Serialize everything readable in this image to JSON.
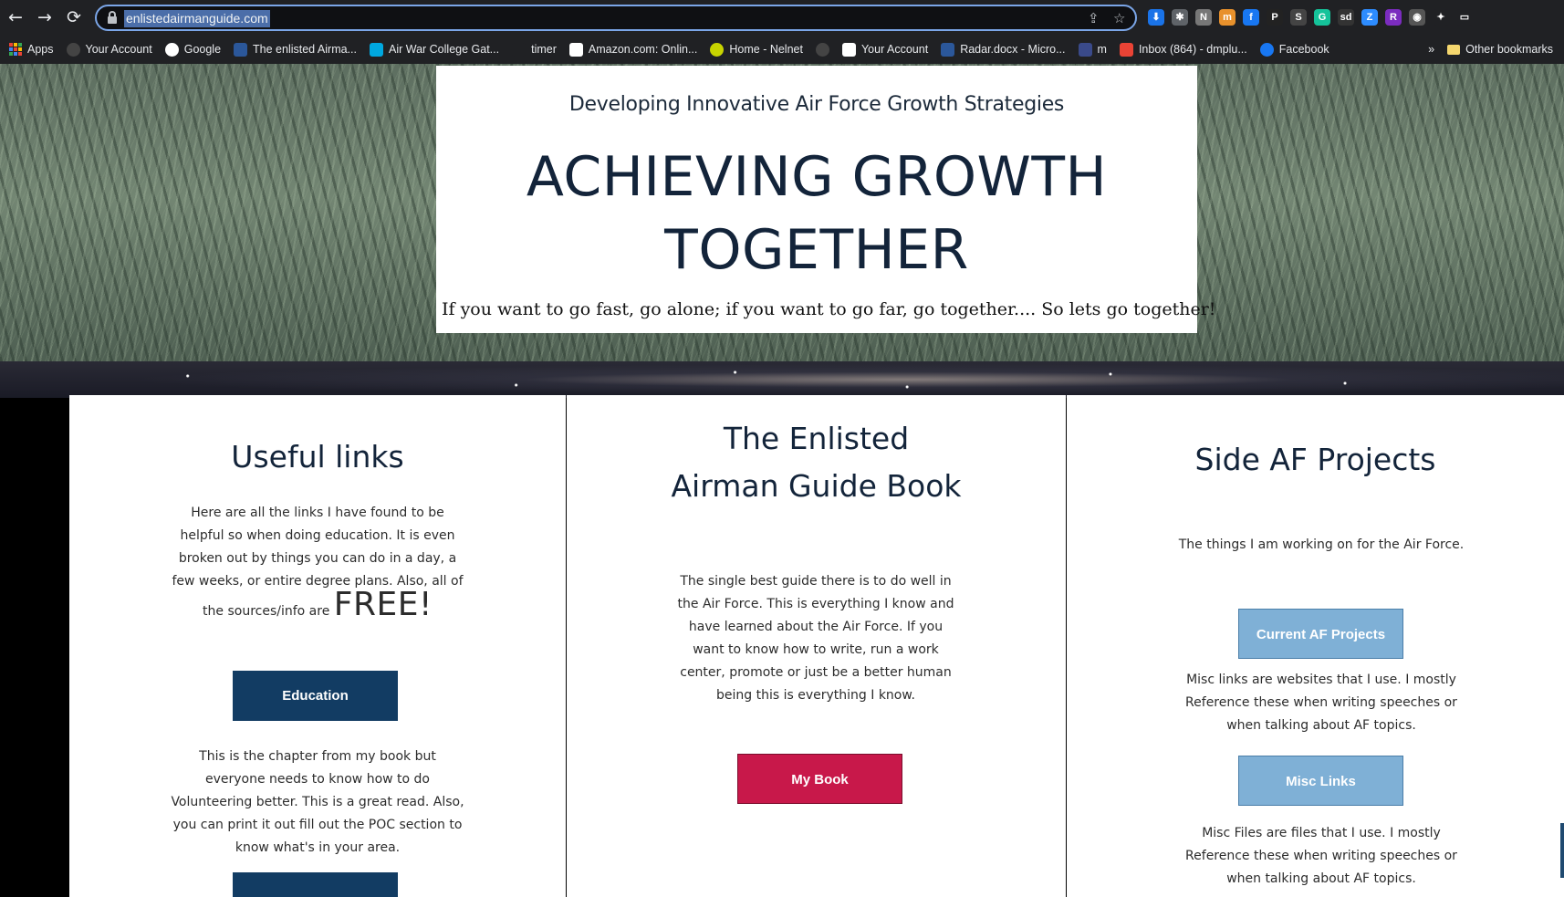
{
  "browser": {
    "url": "enlistedairmanguide.com",
    "nav": {
      "back": "←",
      "forward": "→",
      "reload": "⟳"
    },
    "omnibox_icons": [
      "share-icon",
      "star-icon"
    ],
    "extensions": [
      {
        "name": "download-icon",
        "glyph": "⬇",
        "color": "#1a73e8"
      },
      {
        "name": "puzzle-alt-icon",
        "glyph": "✱",
        "color": "#5f6368"
      },
      {
        "name": "book-ext-icon",
        "glyph": "N",
        "color": "#777777"
      },
      {
        "name": "orange-ext-icon",
        "glyph": "m",
        "color": "#e8912c"
      },
      {
        "name": "fb-ext-icon",
        "glyph": "f",
        "color": "#1877f2"
      },
      {
        "name": "p-ext-icon",
        "glyph": "P",
        "color": "#222222"
      },
      {
        "name": "s-ext-icon",
        "glyph": "S",
        "color": "#444444"
      },
      {
        "name": "grammarly-icon",
        "glyph": "G",
        "color": "#15c39a"
      },
      {
        "name": "sd-ext-icon",
        "glyph": "sd",
        "color": "#333333"
      },
      {
        "name": "zoom-icon",
        "glyph": "Z",
        "color": "#2d8cff"
      },
      {
        "name": "r-ext-icon",
        "glyph": "R",
        "color": "#7b2cbf"
      },
      {
        "name": "globe-ext-icon",
        "glyph": "◉",
        "color": "#555555"
      },
      {
        "name": "extensions-icon",
        "glyph": "✦",
        "color": "#202124"
      },
      {
        "name": "cast-icon",
        "glyph": "▭",
        "color": "#202124"
      }
    ],
    "bookmarks": [
      {
        "label": "Apps",
        "icon": "apps-grid-icon",
        "color": "#ffffff"
      },
      {
        "label": "Your Account",
        "icon": "account-icon",
        "color": "#444444"
      },
      {
        "label": "Google",
        "icon": "google-icon",
        "color": "#ffffff"
      },
      {
        "label": "The enlisted Airma...",
        "icon": "word-icon",
        "color": "#2b579a"
      },
      {
        "label": "Air War College Gat...",
        "icon": "att-icon",
        "color": "#00a8e0"
      },
      {
        "label": "timer",
        "icon": "blank-icon",
        "color": "#202124"
      },
      {
        "label": "Amazon.com: Onlin...",
        "icon": "amazon-icon",
        "color": "#ffffff"
      },
      {
        "label": "Home - Nelnet",
        "icon": "nelnet-icon",
        "color": "#c8d400"
      },
      {
        "label": "",
        "icon": "account-icon",
        "color": "#444444"
      },
      {
        "label": "Your Account",
        "icon": "amazon-icon",
        "color": "#ffffff"
      },
      {
        "label": "Radar.docx - Micro...",
        "icon": "word-icon",
        "color": "#2b579a"
      },
      {
        "label": "m",
        "icon": "usa-icon",
        "color": "#3a4a8a"
      },
      {
        "label": "Inbox (864) - dmplu...",
        "icon": "gmail-icon",
        "color": "#ea4335"
      },
      {
        "label": "Facebook",
        "icon": "facebook-icon",
        "color": "#1877f2"
      }
    ],
    "overflow": "»",
    "other_bookmarks": "Other bookmarks"
  },
  "hero": {
    "subtitle": "Developing Innovative Air Force Growth Strategies",
    "title_line1": "ACHIEVING GROWTH",
    "title_line2": "TOGETHER",
    "quote": "If you want to go fast, go alone; if you want to go far, go together.... So lets go together!"
  },
  "useful_links": {
    "heading": "Useful links",
    "text_line1": "Here are all the links I have found to be",
    "text_line2": "helpful so when doing education. It is even",
    "text_line3": "broken out by things you can do in a day, a",
    "text_line4": "few weeks, or entire degree plans. Also, all of",
    "text_line5a": "the sources/info are ",
    "text_big": "FREE!",
    "button": "Education",
    "text2_line1": "This is the chapter from my book but",
    "text2_line2": "everyone needs to know how to do",
    "text2_line3": "Volunteering better. This is a great read. Also,",
    "text2_line4": "you can print it out fill out the POC section to",
    "text2_line5": "know what's in your area."
  },
  "guide_book": {
    "heading_line1": "The Enlisted",
    "heading_line2": "Airman Guide Book",
    "text_line1": "The single best guide there is to do well in",
    "text_line2": "the Air Force. This is everything I know and",
    "text_line3": "have learned about the Air Force. If you",
    "text_line4": "want to know how to write, run a work",
    "text_line5": "center, promote or just be a better human",
    "text_line6": "being this is everything I know.",
    "button": "My Book"
  },
  "side_projects": {
    "heading": "Side AF Projects",
    "text": "The things I am working on for the Air Force.",
    "button1": "Current AF Projects",
    "misc_text_line1": "Misc links are websites that I use. I mostly",
    "misc_text_line2": "Reference these when writing speeches or",
    "misc_text_line3": "when talking about AF topics.",
    "button2": "Misc Links",
    "files_text_line1": "Misc Files are files that I use. I mostly",
    "files_text_line2": "Reference these when writing speeches or",
    "files_text_line3": "when talking about AF topics."
  }
}
